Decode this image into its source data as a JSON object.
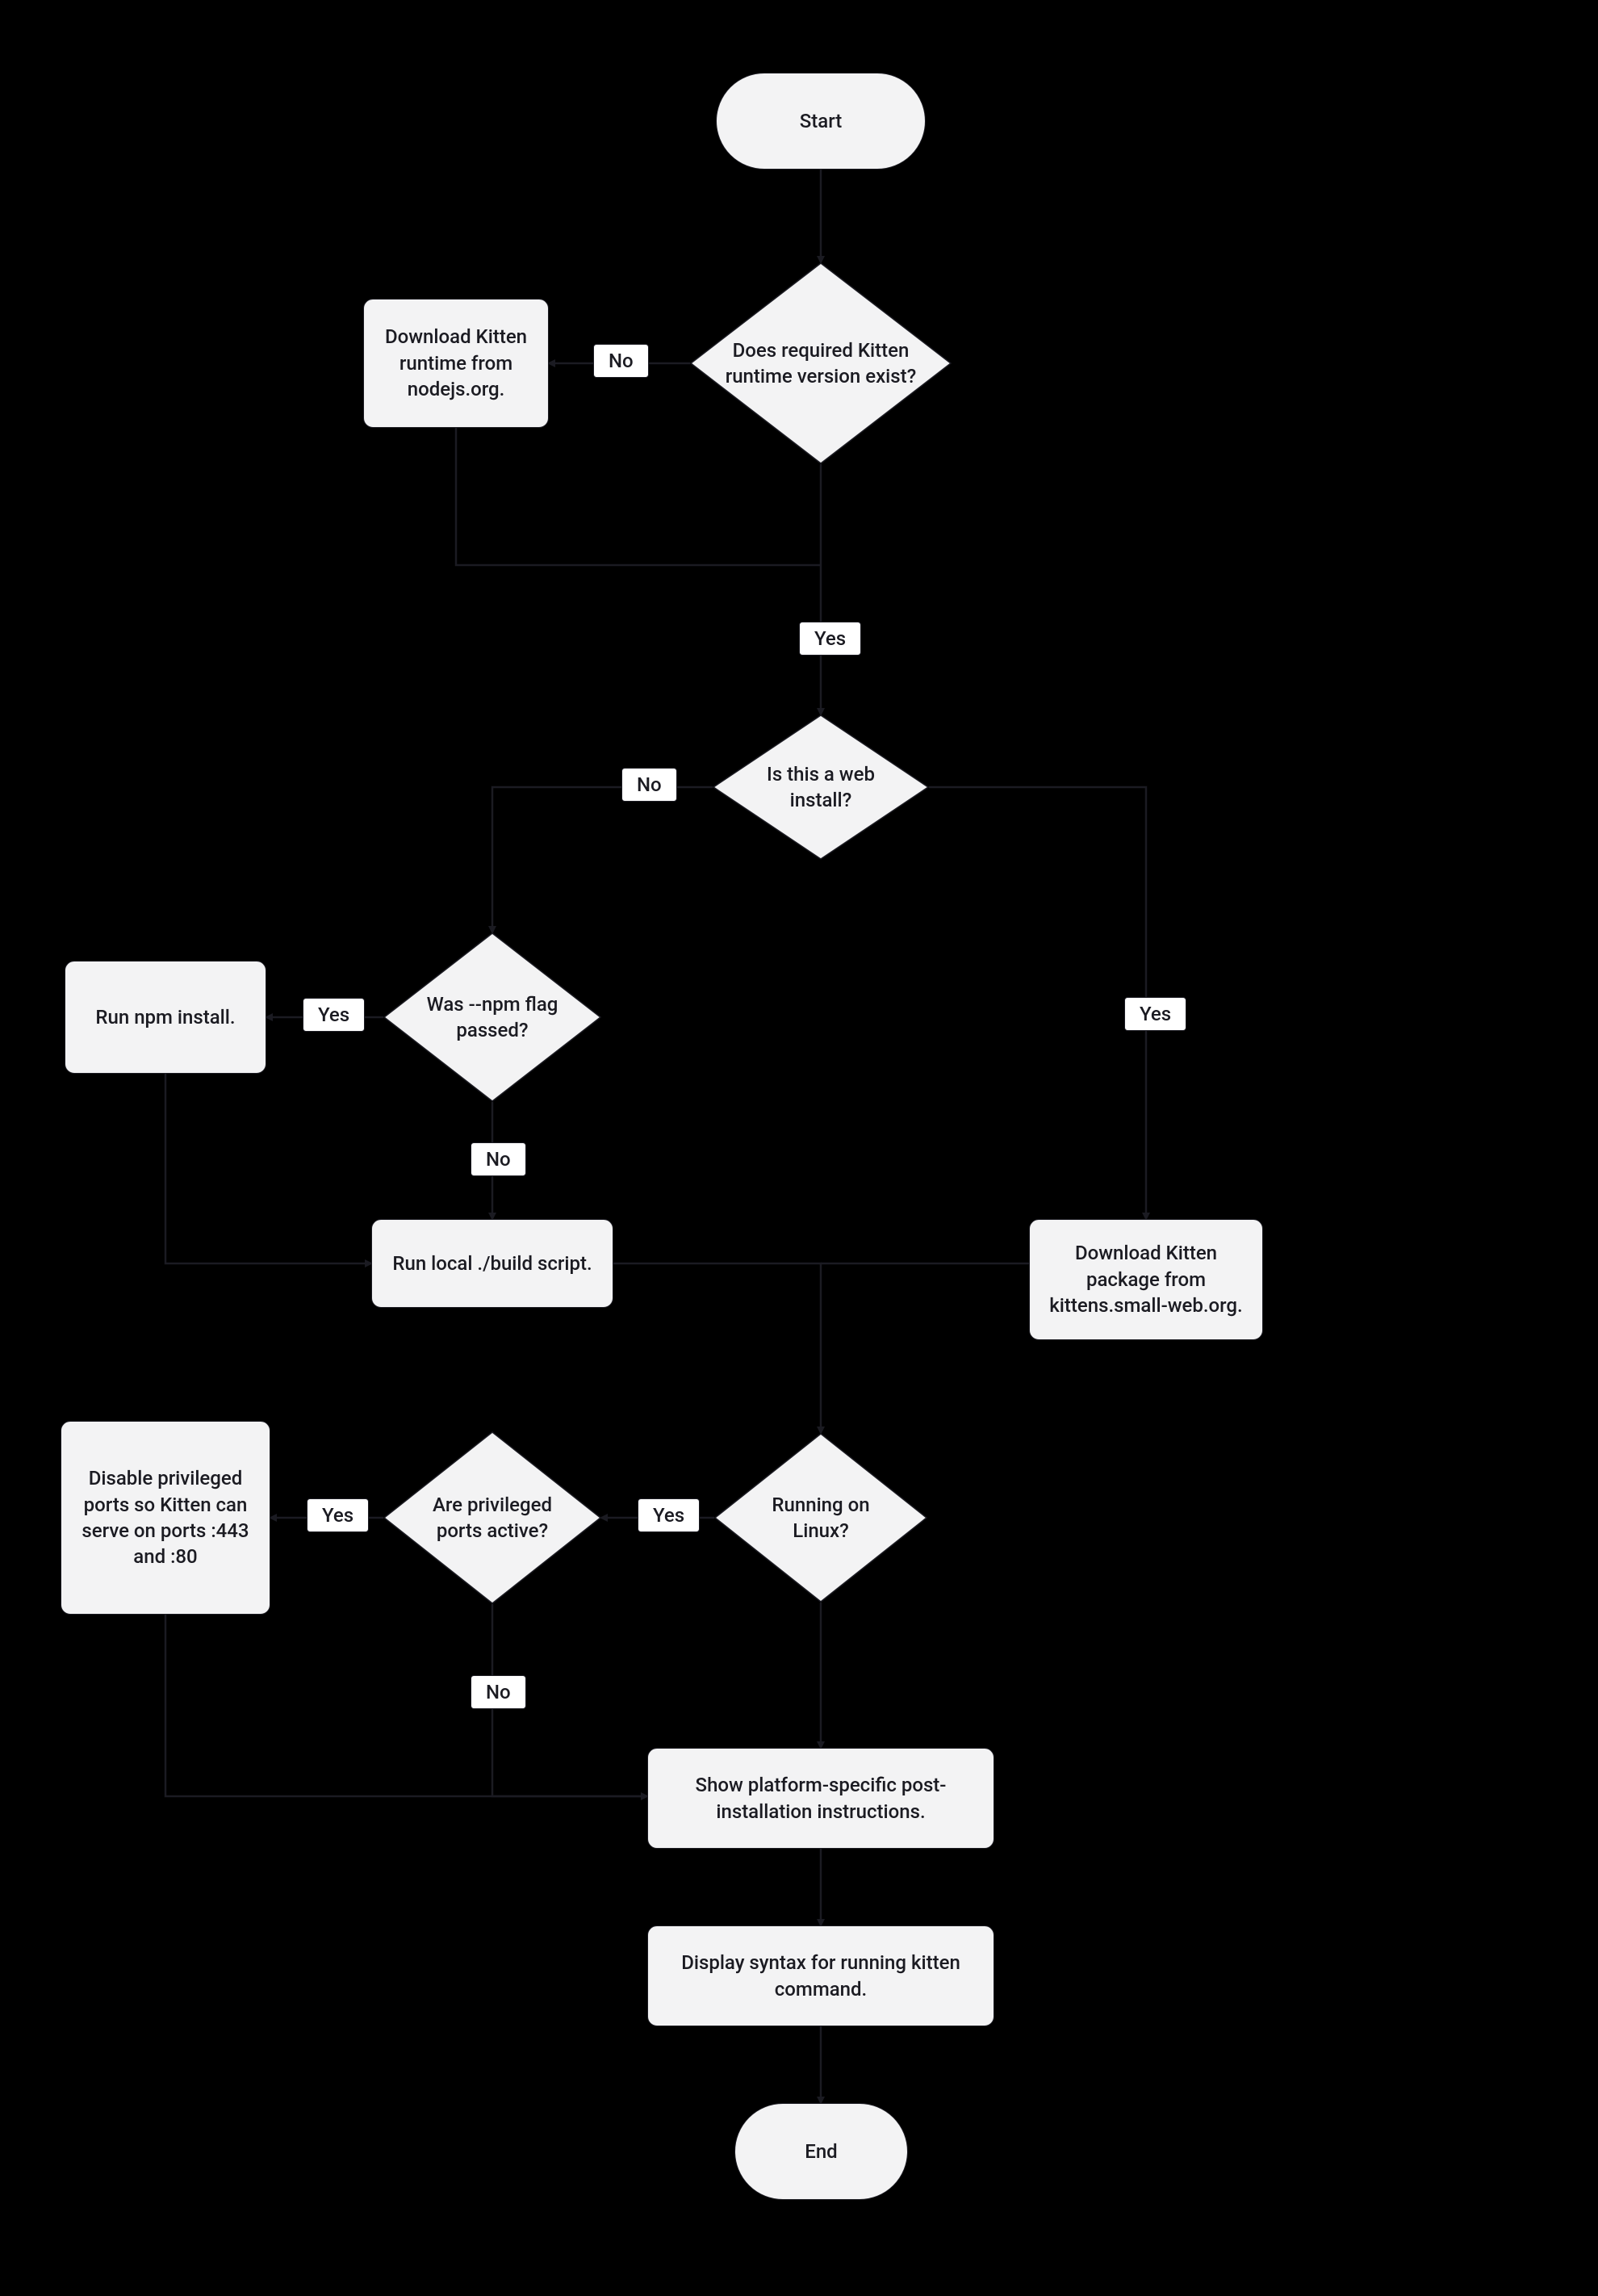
{
  "nodes": {
    "start": "Start",
    "end": "End",
    "q_runtime": "Does required Kitten runtime version exist?",
    "download_runtime": "Download Kitten runtime from nodejs.org.",
    "q_web_install": "Is this a web install?",
    "q_npm_flag": "Was --npm flag passed?",
    "run_npm": "Run npm install.",
    "run_build": "Run local ./build script.",
    "download_pkg": "Download Kitten package from kittens.small-web.org.",
    "q_linux": "Running on Linux?",
    "q_priv_ports": "Are privileged ports active?",
    "disable_ports": "Disable privileged ports so Kitten can serve on ports :443 and :80",
    "post_install": "Show platform-specific post-installation instructions.",
    "display_syntax": "Display syntax for running kitten command."
  },
  "labels": {
    "yes": "Yes",
    "no": "No"
  }
}
